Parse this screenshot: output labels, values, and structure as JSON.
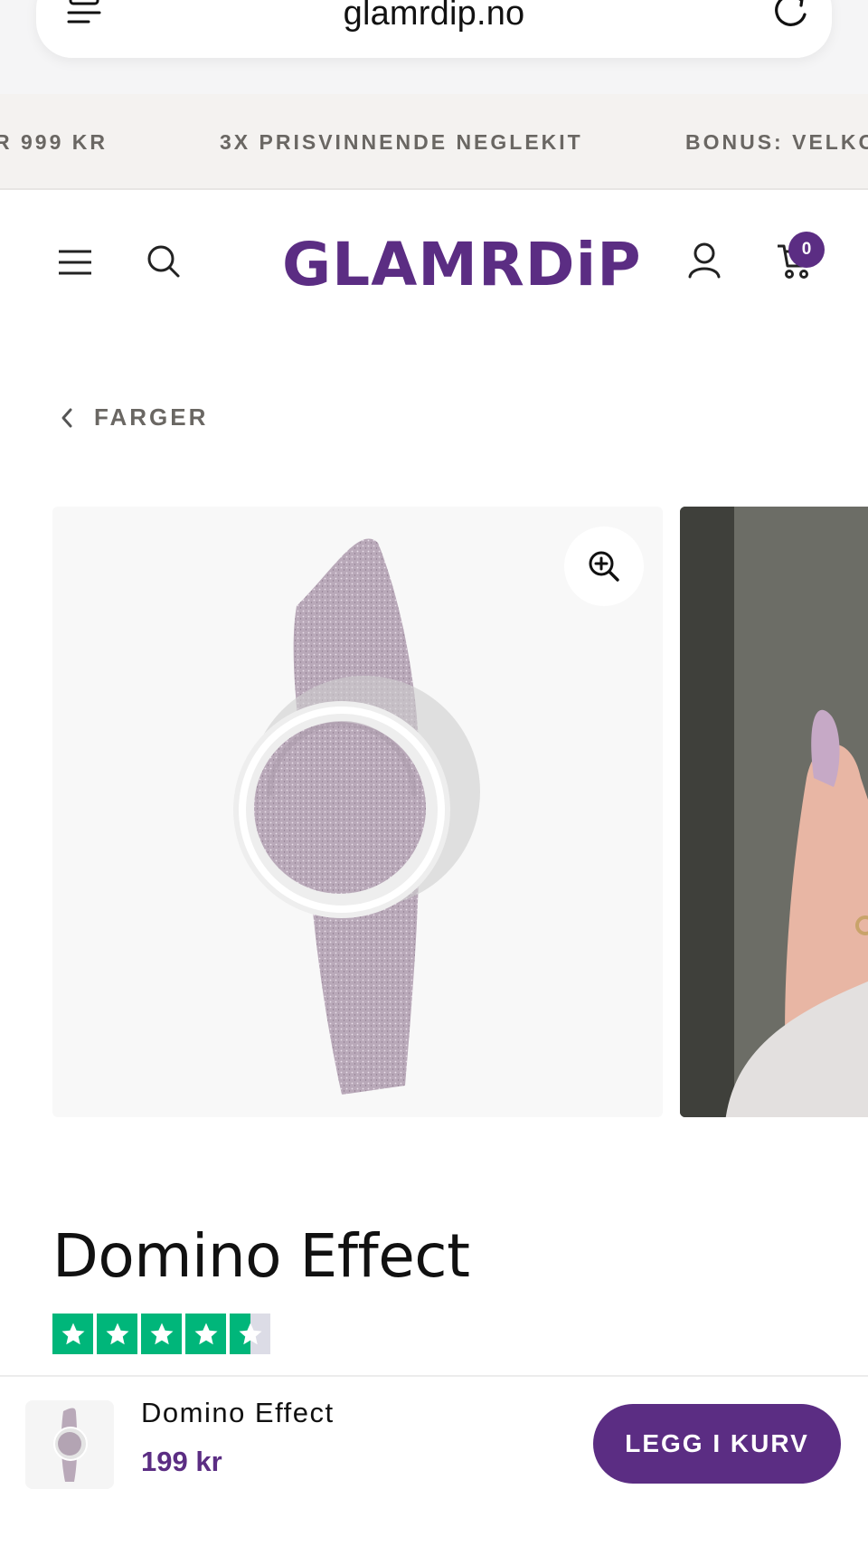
{
  "browser": {
    "url": "glamrdip.no"
  },
  "announcement": {
    "items": [
      "R 999 KR",
      "3X PRISVINNENDE NEGLEKIT",
      "BONUS: VELKO"
    ]
  },
  "header": {
    "logo_text": "GLAMRDiP",
    "cart_count": "0"
  },
  "breadcrumb": {
    "label": "FARGER"
  },
  "product": {
    "title": "Domino Effect",
    "rating": {
      "stars": 4.5,
      "max": 5
    }
  },
  "sticky_bar": {
    "name": "Domino Effect",
    "price": "199 kr",
    "button_label": "LEGG I KURV"
  },
  "colors": {
    "brand": "#5b2d83",
    "trustpilot": "#00b67a"
  }
}
